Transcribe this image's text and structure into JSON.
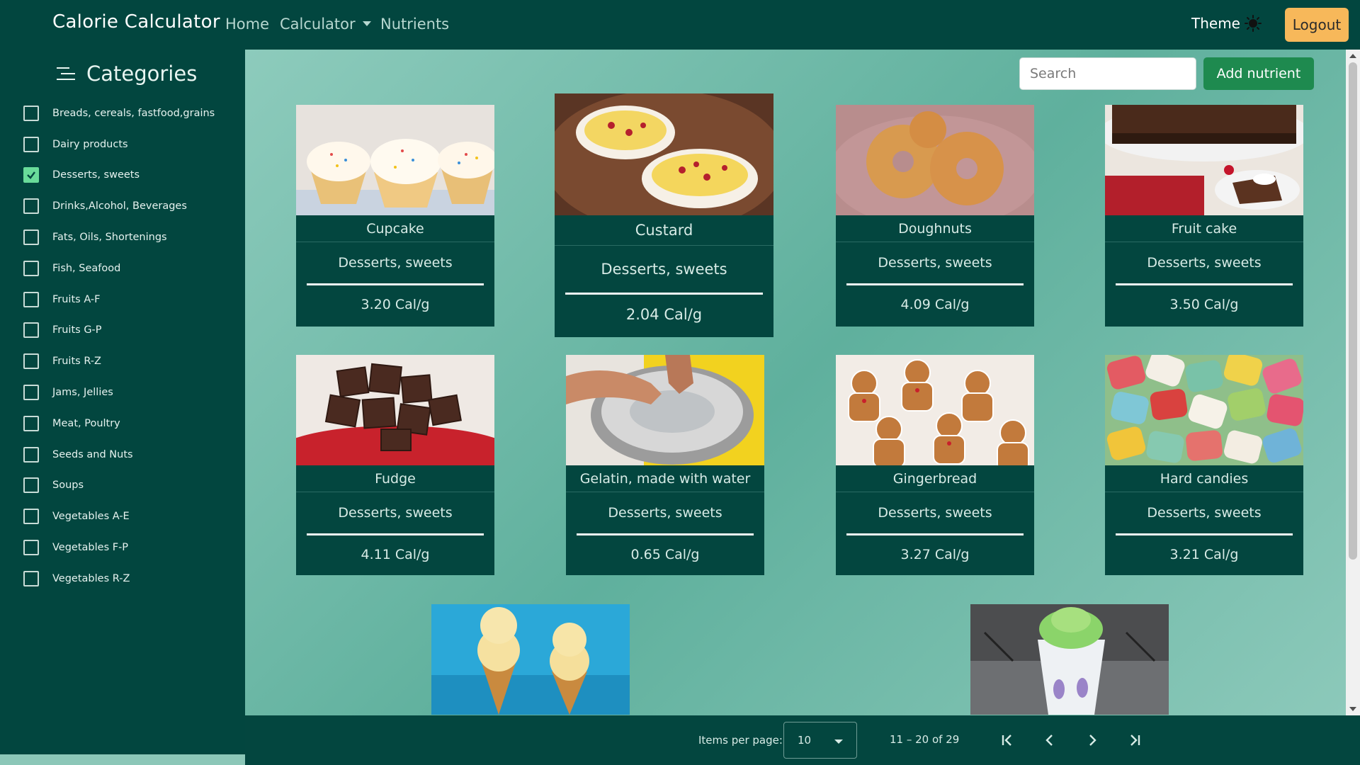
{
  "navbar": {
    "brand": "Calorie Calculator",
    "home": "Home",
    "calculator": "Calculator",
    "nutrients": "Nutrients",
    "theme": "Theme",
    "theme_icon": "sun-icon",
    "logout": "Logout"
  },
  "sidebar": {
    "title": "Categories",
    "title_icon": "menu-icon",
    "categories": [
      {
        "label": "Breads, cereals, fastfood,grains",
        "checked": false
      },
      {
        "label": "Dairy products",
        "checked": false
      },
      {
        "label": "Desserts, sweets",
        "checked": true
      },
      {
        "label": "Drinks,Alcohol, Beverages",
        "checked": false
      },
      {
        "label": "Fats, Oils, Shortenings",
        "checked": false
      },
      {
        "label": "Fish, Seafood",
        "checked": false
      },
      {
        "label": "Fruits A-F",
        "checked": false
      },
      {
        "label": "Fruits G-P",
        "checked": false
      },
      {
        "label": "Fruits R-Z",
        "checked": false
      },
      {
        "label": "Jams, Jellies",
        "checked": false
      },
      {
        "label": "Meat, Poultry",
        "checked": false
      },
      {
        "label": "Seeds and Nuts",
        "checked": false
      },
      {
        "label": "Soups",
        "checked": false
      },
      {
        "label": "Vegetables A-E",
        "checked": false
      },
      {
        "label": "Vegetables F-P",
        "checked": false
      },
      {
        "label": "Vegetables R-Z",
        "checked": false
      }
    ]
  },
  "toolbar": {
    "search_placeholder": "Search",
    "add_label": "Add nutrient"
  },
  "cards": [
    {
      "name": "Cupcake",
      "category": "Desserts, sweets",
      "calories": "3.20 Cal/g"
    },
    {
      "name": "Custard",
      "category": "Desserts, sweets",
      "calories": "2.04 Cal/g"
    },
    {
      "name": "Doughnuts",
      "category": "Desserts, sweets",
      "calories": "4.09 Cal/g"
    },
    {
      "name": "Fruit cake",
      "category": "Desserts, sweets",
      "calories": "3.50 Cal/g"
    },
    {
      "name": "Fudge",
      "category": "Desserts, sweets",
      "calories": "4.11 Cal/g"
    },
    {
      "name": "Gelatin, made with water",
      "category": "Desserts, sweets",
      "calories": "0.65 Cal/g"
    },
    {
      "name": "Gingerbread",
      "category": "Desserts, sweets",
      "calories": "3.27 Cal/g"
    },
    {
      "name": "Hard candies",
      "category": "Desserts, sweets",
      "calories": "3.21 Cal/g"
    }
  ],
  "paginator": {
    "items_per_page_label": "Items per page:",
    "page_size": "10",
    "range": "11 – 20 of 29"
  },
  "colors": {
    "primary": "#02463f",
    "accent": "#f7b85a",
    "add_button": "#1e8a4f",
    "checked": "#69db9a"
  }
}
